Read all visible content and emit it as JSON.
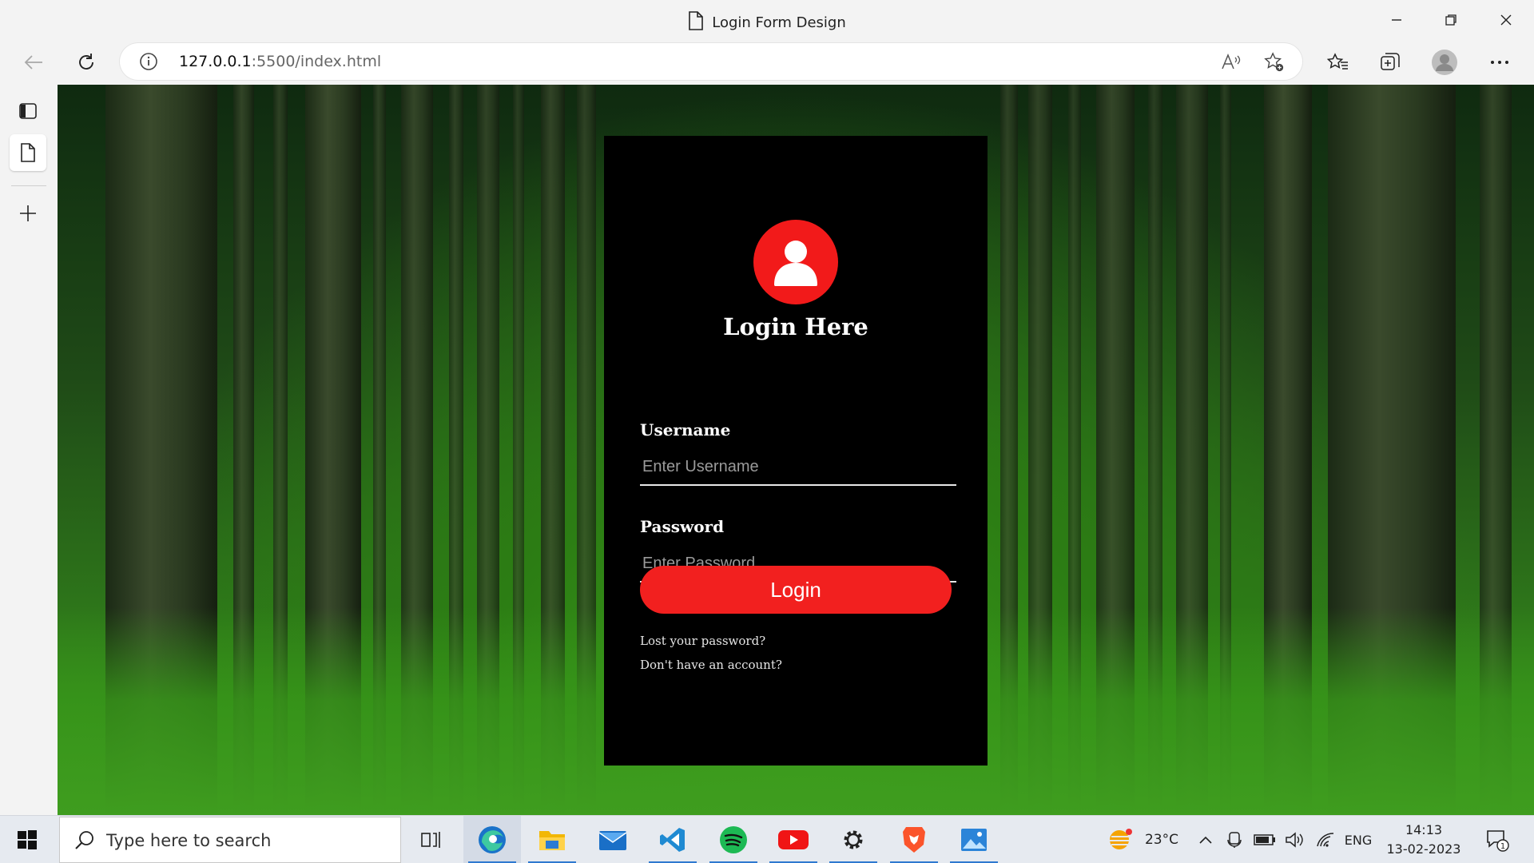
{
  "window": {
    "title": "Login Form Design"
  },
  "browser": {
    "url_host": "127.0.0.1",
    "url_rest": ":5500/index.html",
    "profile_icon": "avatar-icon"
  },
  "login": {
    "title": "Login Here",
    "username_label": "Username",
    "username_placeholder": "Enter Username",
    "username_value": "",
    "password_label": "Password",
    "password_placeholder": "Enter Password",
    "password_value": "",
    "button_label": "Login",
    "lost_password": "Lost your password?",
    "no_account": "Don't have an account?",
    "accent_color": "#f21a1a",
    "card_color": "#000000"
  },
  "taskbar": {
    "search_placeholder": "Type here to search",
    "apps": [
      "task-view",
      "edge",
      "file-explorer",
      "mail",
      "vscode",
      "spotify",
      "youtube",
      "settings",
      "brave",
      "photos"
    ],
    "weather": "23°C",
    "language": "ENG",
    "time": "14:13",
    "date": "13-02-2023",
    "notification_count": "1"
  }
}
